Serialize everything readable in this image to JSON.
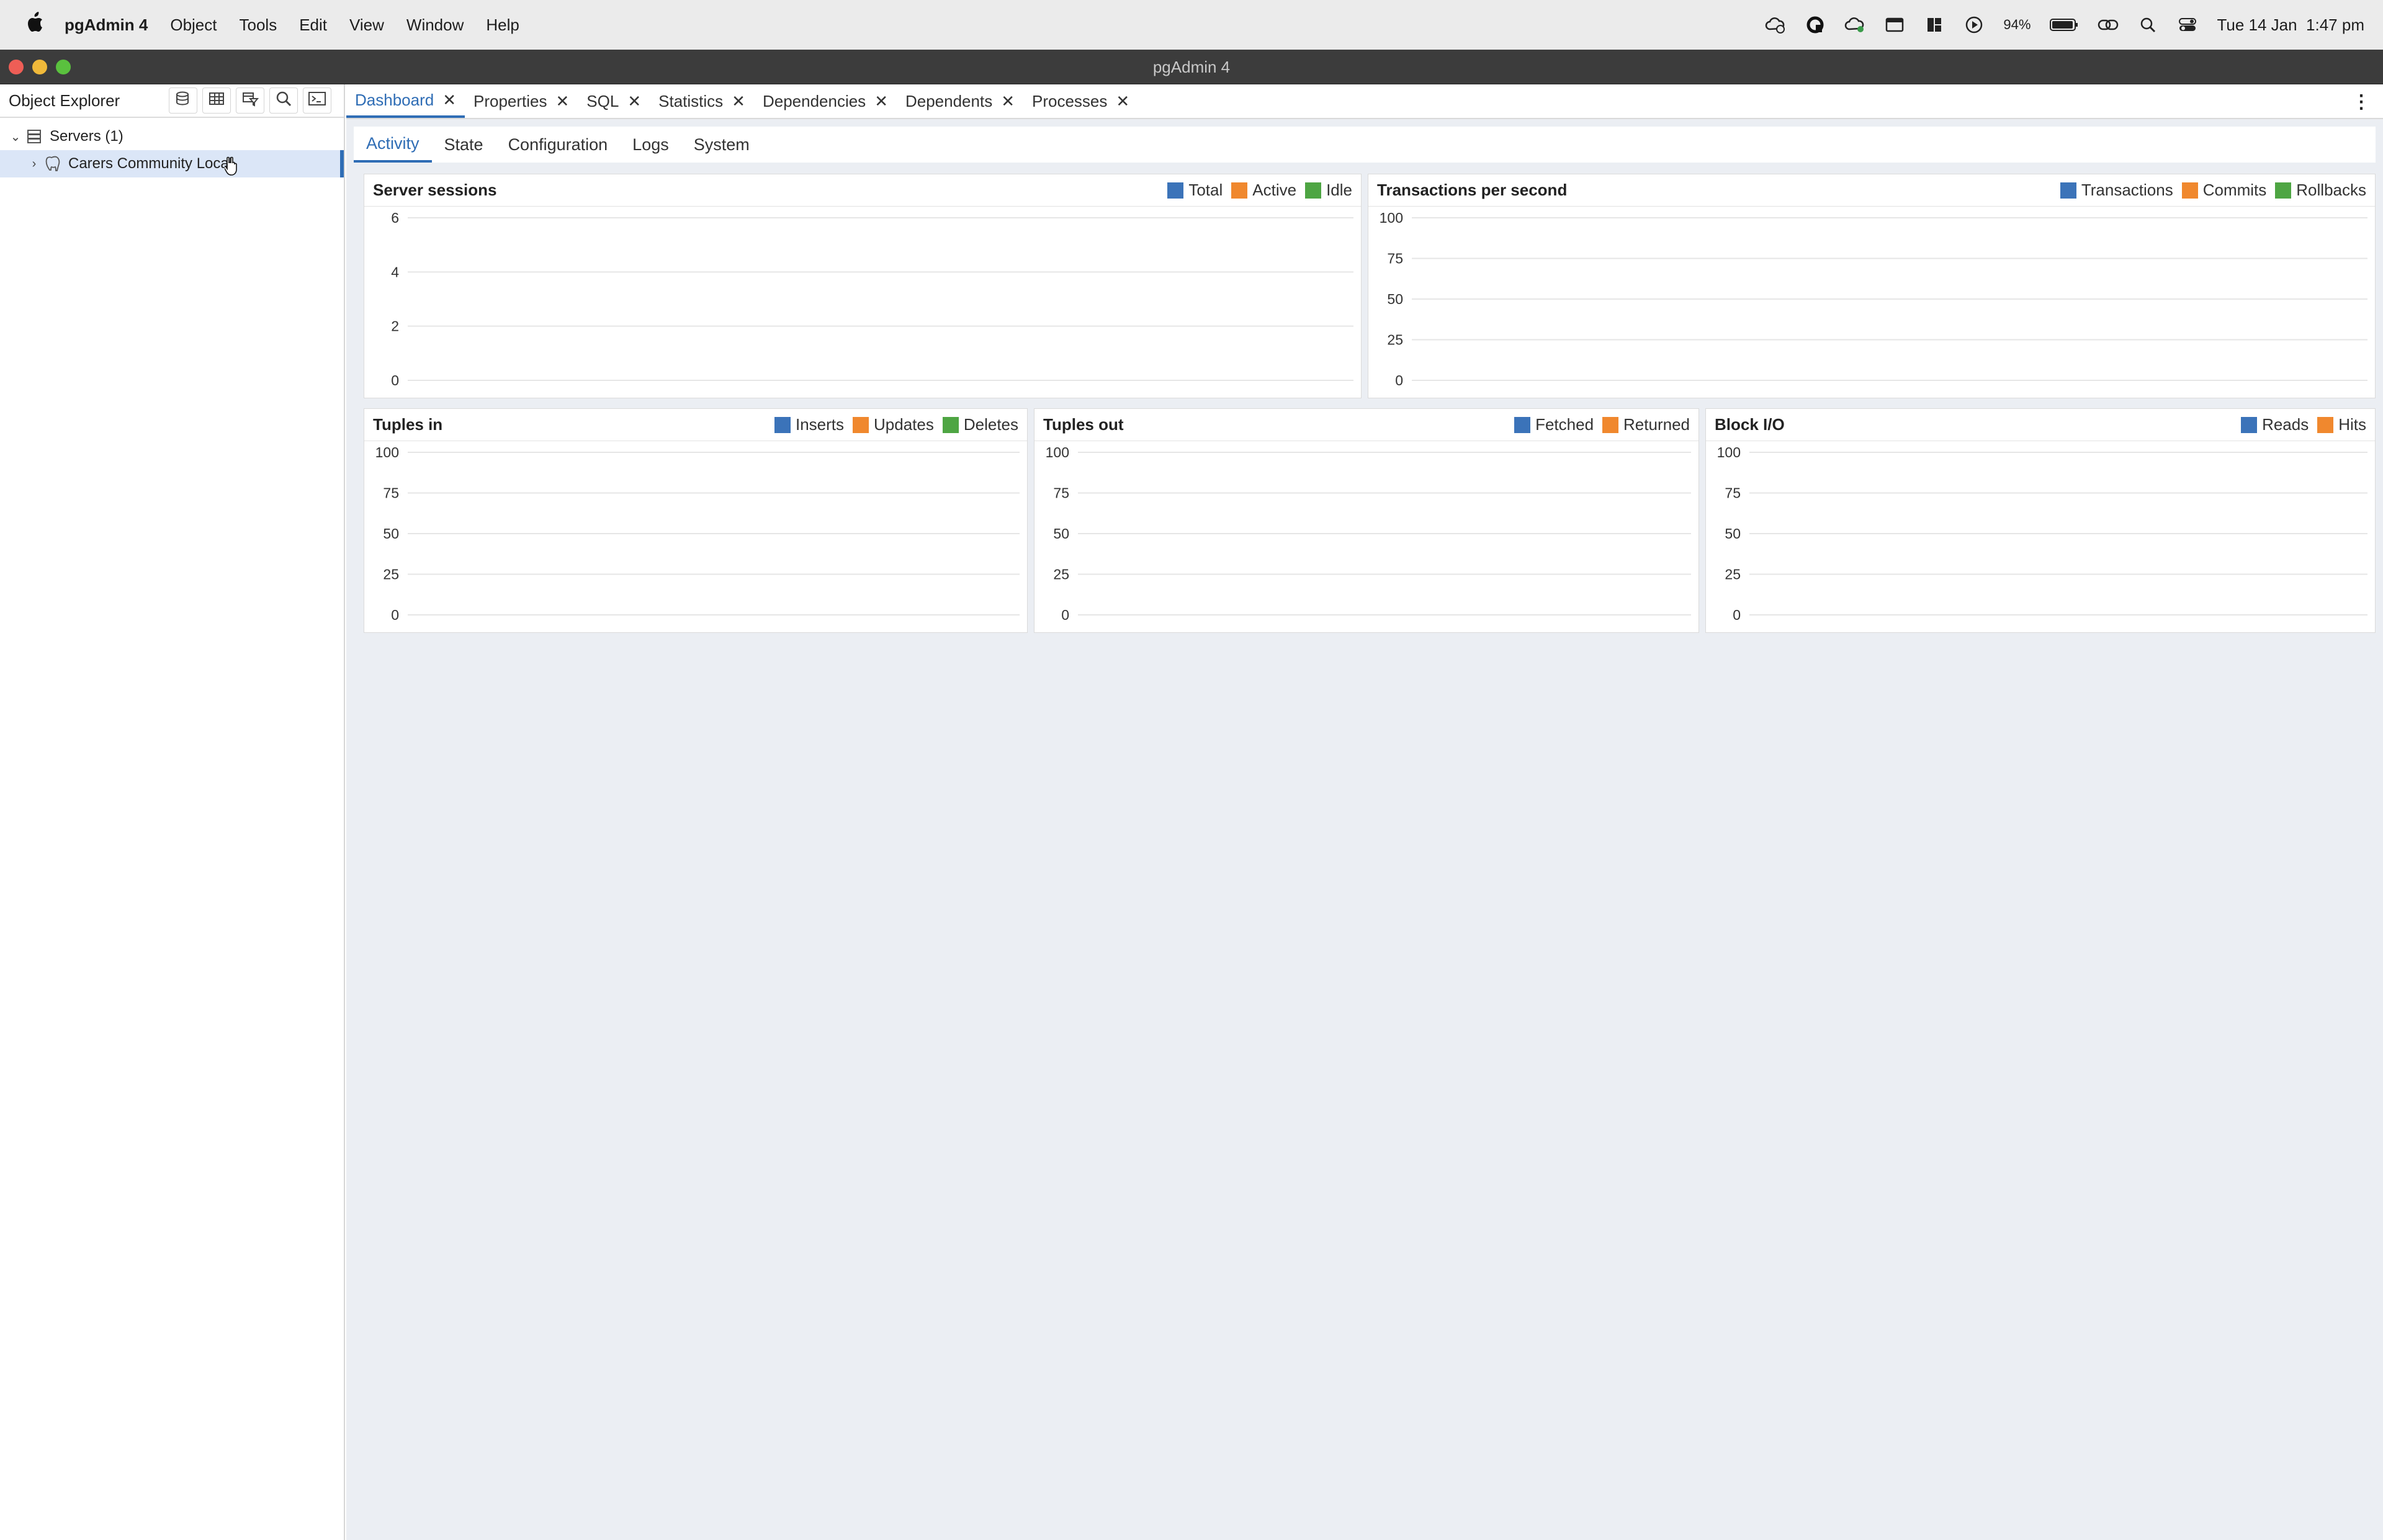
{
  "menubar": {
    "app_name": "pgAdmin 4",
    "items": [
      "Object",
      "Tools",
      "Edit",
      "View",
      "Window",
      "Help"
    ],
    "battery": "94%",
    "clock": "Tue 14 Jan  1:47 pm"
  },
  "window": {
    "title": "pgAdmin 4"
  },
  "object_explorer": {
    "title": "Object Explorer",
    "tree": {
      "servers_label": "Servers (1)",
      "server_label": "Carers Community Local"
    }
  },
  "tabs": [
    "Dashboard",
    "Properties",
    "SQL",
    "Statistics",
    "Dependencies",
    "Dependents",
    "Processes"
  ],
  "subtabs": [
    "Activity",
    "State",
    "Configuration",
    "Logs",
    "System"
  ],
  "colors": {
    "blue": "#3b73b9",
    "orange": "#f0882e",
    "green": "#4ea543",
    "accent": "#2f6db5"
  },
  "panels": {
    "sessions": {
      "title": "Server sessions",
      "legend": [
        "Total",
        "Active",
        "Idle"
      ]
    },
    "tps": {
      "title": "Transactions per second",
      "legend": [
        "Transactions",
        "Commits",
        "Rollbacks"
      ]
    },
    "tuples_in": {
      "title": "Tuples in",
      "legend": [
        "Inserts",
        "Updates",
        "Deletes"
      ]
    },
    "tuples_out": {
      "title": "Tuples out",
      "legend": [
        "Fetched",
        "Returned"
      ]
    },
    "block_io": {
      "title": "Block I/O",
      "legend": [
        "Reads",
        "Hits"
      ]
    }
  },
  "chart_data": [
    {
      "type": "line",
      "title": "Server sessions",
      "yticks": [
        0,
        2,
        4,
        6
      ],
      "ylim": [
        0,
        6
      ],
      "grid": true,
      "legend": "top-right",
      "series": [
        {
          "name": "Total",
          "values": []
        },
        {
          "name": "Active",
          "values": []
        },
        {
          "name": "Idle",
          "values": []
        }
      ]
    },
    {
      "type": "line",
      "title": "Transactions per second",
      "yticks": [
        0,
        25,
        50,
        75,
        100
      ],
      "ylim": [
        0,
        100
      ],
      "grid": true,
      "legend": "top-right",
      "series": [
        {
          "name": "Transactions",
          "values": []
        },
        {
          "name": "Commits",
          "values": []
        },
        {
          "name": "Rollbacks",
          "values": []
        }
      ]
    },
    {
      "type": "line",
      "title": "Tuples in",
      "yticks": [
        0,
        25,
        50,
        75,
        100
      ],
      "ylim": [
        0,
        100
      ],
      "grid": true,
      "legend": "top-right",
      "series": [
        {
          "name": "Inserts",
          "values": []
        },
        {
          "name": "Updates",
          "values": []
        },
        {
          "name": "Deletes",
          "values": []
        }
      ]
    },
    {
      "type": "line",
      "title": "Tuples out",
      "yticks": [
        0,
        25,
        50,
        75,
        100
      ],
      "ylim": [
        0,
        100
      ],
      "grid": true,
      "legend": "top-right",
      "series": [
        {
          "name": "Fetched",
          "values": []
        },
        {
          "name": "Returned",
          "values": []
        }
      ]
    },
    {
      "type": "line",
      "title": "Block I/O",
      "yticks": [
        0,
        25,
        50,
        75,
        100
      ],
      "ylim": [
        0,
        100
      ],
      "grid": true,
      "legend": "top-right",
      "series": [
        {
          "name": "Reads",
          "values": []
        },
        {
          "name": "Hits",
          "values": []
        }
      ]
    }
  ]
}
